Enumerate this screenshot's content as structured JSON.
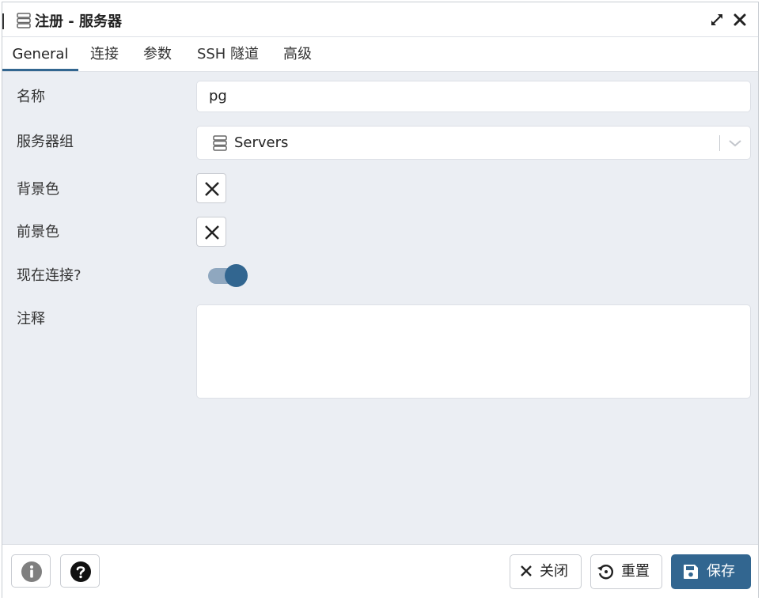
{
  "window": {
    "title": "注册 - 服务器"
  },
  "tabs": [
    {
      "label": "General",
      "active": true
    },
    {
      "label": "连接",
      "active": false
    },
    {
      "label": "参数",
      "active": false
    },
    {
      "label": "SSH 隧道",
      "active": false
    },
    {
      "label": "高级",
      "active": false
    }
  ],
  "form": {
    "name_label": "名称",
    "name_value": "pg",
    "server_group_label": "服务器组",
    "server_group_value": "Servers",
    "bg_color_label": "背景色",
    "fg_color_label": "前景色",
    "connect_now_label": "现在连接?",
    "connect_now_value": true,
    "comments_label": "注释",
    "comments_value": ""
  },
  "footer": {
    "info_icon": "info-icon",
    "help_icon": "help-icon",
    "close_label": "关闭",
    "reset_label": "重置",
    "save_label": "保存"
  },
  "colors": {
    "accent": "#326690",
    "toggle_track": "#8fa7bf",
    "body_bg": "#ebeef3",
    "border": "#dde0e6"
  }
}
